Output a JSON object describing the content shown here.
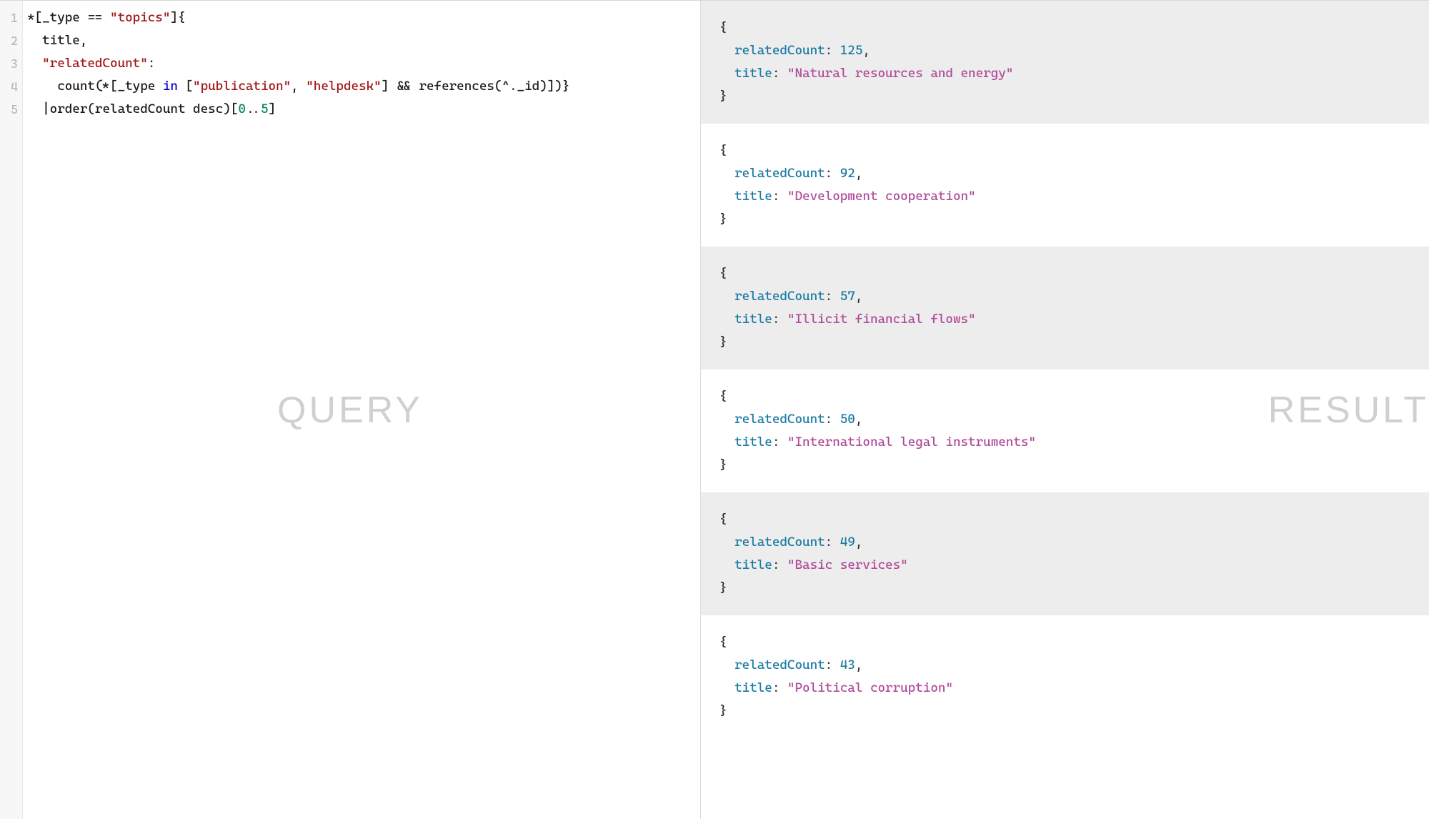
{
  "labels": {
    "query": "QUERY",
    "result": "RESULT"
  },
  "code": {
    "line1": {
      "pre": "*[_type == ",
      "str": "\"topics\"",
      "post": "]{"
    },
    "line2": "  title,",
    "line3": {
      "indent": "  ",
      "str": "\"relatedCount\"",
      "post": ":"
    },
    "line4": {
      "indent": "    count(*[_type ",
      "kw": "in",
      "mid": " [",
      "str1": "\"publication\"",
      "sep": ", ",
      "str2": "\"helpdesk\"",
      "post": "] && references(^._id)])}"
    },
    "line5": {
      "pre": "  |order(relatedCount desc)[",
      "n1": "0",
      "dots": "..",
      "n2": "5",
      "post": "]"
    }
  },
  "line_numbers": [
    "1",
    "2",
    "3",
    "4",
    "5"
  ],
  "results": [
    {
      "relatedCount": 125,
      "title": "Natural resources and energy"
    },
    {
      "relatedCount": 92,
      "title": "Development cooperation"
    },
    {
      "relatedCount": 57,
      "title": "Illicit financial flows"
    },
    {
      "relatedCount": 50,
      "title": "International legal instruments"
    },
    {
      "relatedCount": 49,
      "title": "Basic services"
    },
    {
      "relatedCount": 43,
      "title": "Political corruption"
    }
  ],
  "res_labels": {
    "relatedCount": "relatedCount",
    "title": "title"
  }
}
